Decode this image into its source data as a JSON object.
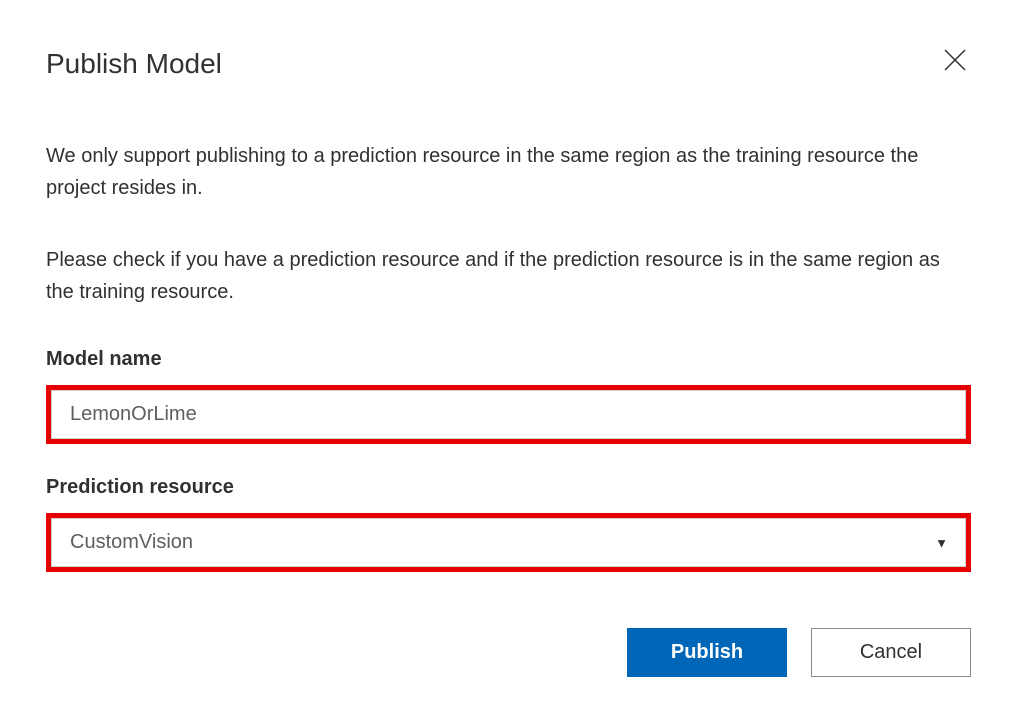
{
  "dialog": {
    "title": "Publish Model",
    "description1": "We only support publishing to a prediction resource in the same region as the training resource the project resides in.",
    "description2": "Please check if you have a prediction resource and if the prediction resource is in the same region as the training resource."
  },
  "form": {
    "modelName": {
      "label": "Model name",
      "value": "LemonOrLime"
    },
    "predictionResource": {
      "label": "Prediction resource",
      "value": "CustomVision"
    }
  },
  "buttons": {
    "publish": "Publish",
    "cancel": "Cancel"
  }
}
